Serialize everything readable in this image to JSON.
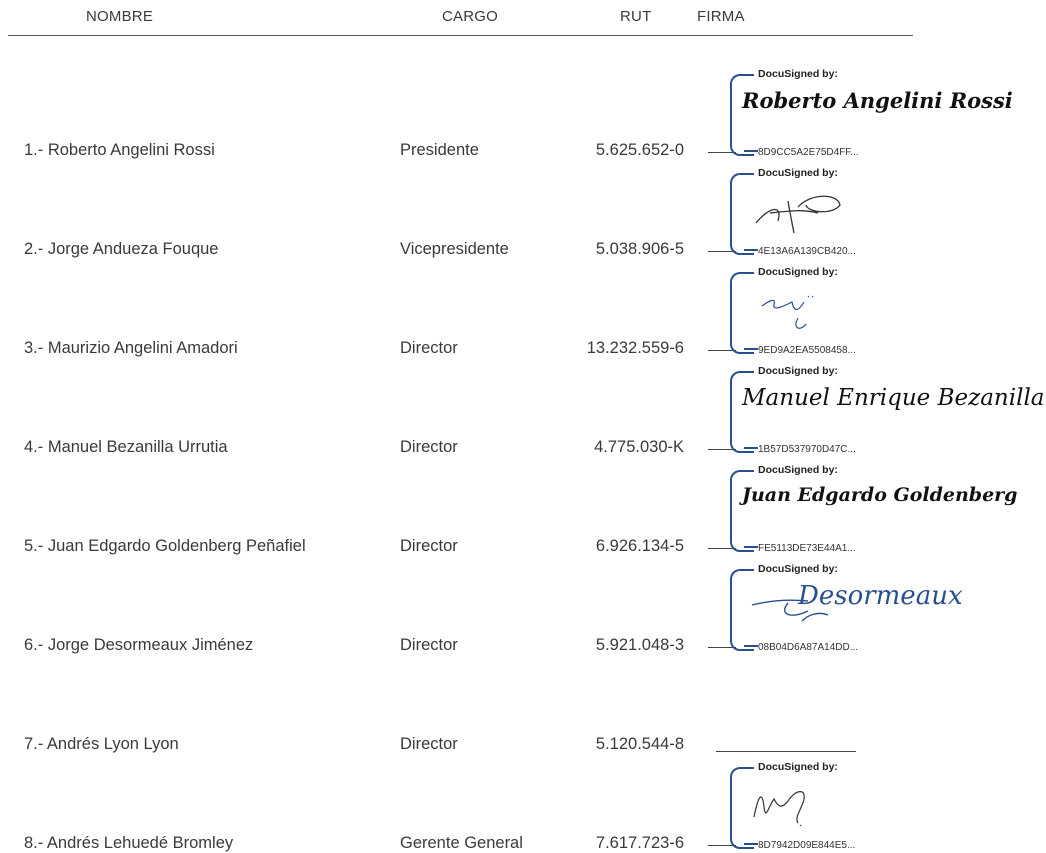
{
  "header": {
    "nombre": "NOMBRE",
    "cargo": "CARGO",
    "rut": "RUT",
    "firma": "FIRMA"
  },
  "signatories": [
    {
      "name": "1.- Roberto Angelini Rossi",
      "cargo": "Presidente",
      "rut": "5.625.652-0",
      "sig": {
        "by": "DocuSigned by:",
        "text": "Roberto Angelini Rossi",
        "code": "8D9CC5A2E75D4FF..."
      }
    },
    {
      "name": "2.- Jorge Andueza Fouque",
      "cargo": "Vicepresidente",
      "rut": "5.038.906-5",
      "sig": {
        "by": "DocuSigned by:",
        "text": "",
        "code": "4E13A6A139CB420..."
      }
    },
    {
      "name": "3.- Maurizio Angelini Amadori",
      "cargo": "Director",
      "rut": "13.232.559-6",
      "sig": {
        "by": "DocuSigned by:",
        "text": "",
        "code": "9ED9A2EA5508458..."
      }
    },
    {
      "name": "4.- Manuel Bezanilla Urrutia",
      "cargo": "Director",
      "rut": "4.775.030-K",
      "sig": {
        "by": "DocuSigned by:",
        "text": "Manuel Enrique Bezanilla",
        "code": "1B57D537970D47C..."
      }
    },
    {
      "name": "5.- Juan Edgardo Goldenberg Peñafiel",
      "cargo": "Director",
      "rut": "6.926.134-5",
      "sig": {
        "by": "DocuSigned by:",
        "text": "Juan Edgardo Goldenberg",
        "code": "FE5113DE73E44A1..."
      }
    },
    {
      "name": "6.- Jorge Desormeaux Jiménez",
      "cargo": "Director",
      "rut": "5.921.048-3",
      "sig": {
        "by": "DocuSigned by:",
        "text": "Desormeaux",
        "code": "08B04D6A87A14DD..."
      }
    },
    {
      "name": "7.- Andrés Lyon Lyon",
      "cargo": "Director",
      "rut": "5.120.544-8",
      "sig": null
    },
    {
      "name": "8.- Andrés Lehuedé Bromley",
      "cargo": "Gerente General",
      "rut": "7.617.723-6",
      "sig": {
        "by": "DocuSigned by:",
        "text": "",
        "code": "8D7942D09E844E5..."
      }
    }
  ],
  "colors": {
    "docusign_frame": "#2a4f8f",
    "text": "#3a3a3a"
  }
}
